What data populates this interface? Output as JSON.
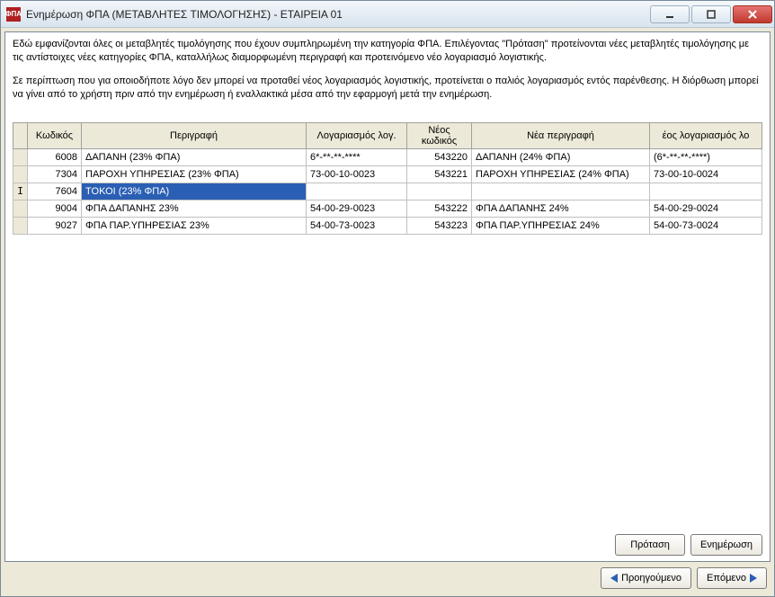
{
  "titlebar": {
    "icon_text": "ΦΠΑ",
    "title": "Ενημέρωση ΦΠΑ (ΜΕΤΑΒΛΗΤΕΣ ΤΙΜΟΛΟΓΗΣΗΣ) - ΕΤΑΙΡΕΙΑ 01"
  },
  "info": {
    "para1": "Εδώ εμφανίζονται όλες οι μεταβλητές τιμολόγησης που έχουν συμπληρωμένη την κατηγορία ΦΠΑ. Επιλέγοντας \"Πρόταση\" προτείνονται νέες μεταβλητές τιμολόγησης με τις αντίστοιχες νέες κατηγορίες ΦΠΑ, καταλλήλως διαμορφωμένη περιγραφή και προτεινόμενο νέο λογαριασμό λογιστικής.",
    "para2": "Σε περίπτωση που για οποιοδήποτε λόγο δεν μπορεί να προταθεί νέος λογαριασμός λογιστικής, προτείνεται ο παλιός λογαριασμός εντός παρένθεσης. Η διόρθωση μπορεί να γίνει από το χρήστη πριν από την ενημέρωση ή εναλλακτικά μέσα από την εφαρμογή μετά την ενημέρωση."
  },
  "table": {
    "headers": {
      "code": "Κωδικός",
      "desc": "Περιγραφή",
      "account": "Λογαριασμός λογ.",
      "new_code": "Νέος κωδικός",
      "new_desc": "Νέα περιγραφή",
      "new_account": "έος λογαριασμός λο"
    },
    "rows": [
      {
        "ind": "",
        "code": "6008",
        "desc": "ΔΑΠΑΝΗ (23% ΦΠΑ)",
        "account": "6*-**-**-****",
        "new_code": "543220",
        "new_desc": "ΔΑΠΑΝΗ (24% ΦΠΑ)",
        "new_account": "(6*-**-**-****)"
      },
      {
        "ind": "",
        "code": "7304",
        "desc": "ΠΑΡΟΧΗ ΥΠΗΡΕΣΙΑΣ (23% ΦΠΑ)",
        "account": "73-00-10-0023",
        "new_code": "543221",
        "new_desc": "ΠΑΡΟΧΗ ΥΠΗΡΕΣΙΑΣ (24% ΦΠΑ)",
        "new_account": "73-00-10-0024"
      },
      {
        "ind": "I",
        "code": "7604",
        "desc": "ΤΟΚΟΙ (23% ΦΠΑ)",
        "account": "",
        "new_code": "",
        "new_desc": "",
        "new_account": "",
        "selected": true
      },
      {
        "ind": "",
        "code": "9004",
        "desc": "ΦΠΑ ΔΑΠΑΝΗΣ 23%",
        "account": "54-00-29-0023",
        "new_code": "543222",
        "new_desc": "ΦΠΑ ΔΑΠΑΝΗΣ 24%",
        "new_account": "54-00-29-0024"
      },
      {
        "ind": "",
        "code": "9027",
        "desc": "ΦΠΑ ΠΑΡ.ΥΠΗΡΕΣΙΑΣ 23%",
        "account": "54-00-73-0023",
        "new_code": "543223",
        "new_desc": "ΦΠΑ ΠΑΡ.ΥΠΗΡΕΣΙΑΣ 24%",
        "new_account": "54-00-73-0024"
      }
    ]
  },
  "buttons": {
    "propose": "Πρόταση",
    "update": "Ενημέρωση",
    "prev": "Προηγούμενο",
    "next": "Επόμενο"
  }
}
